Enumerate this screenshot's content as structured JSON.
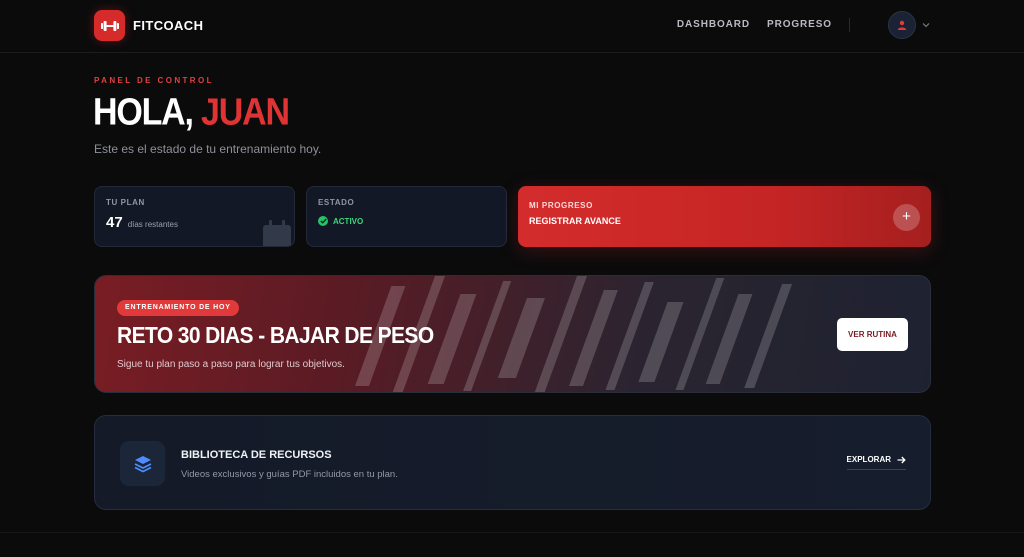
{
  "header": {
    "brand": "FITCOACH",
    "nav": [
      {
        "label": "DASHBOARD"
      },
      {
        "label": "PROGRESO"
      }
    ]
  },
  "hero": {
    "eyebrow": "PANEL DE CONTROL",
    "greeting": "HOLA,",
    "name": "JUAN",
    "subtitle": "Este es el estado de tu entrenamiento hoy."
  },
  "stats": {
    "plan": {
      "label": "TU PLAN",
      "value": "47",
      "unit": "días restantes"
    },
    "status": {
      "label": "ESTADO",
      "value": "ACTIVO"
    },
    "progress": {
      "label": "MI PROGRESO",
      "action": "REGISTRAR AVANCE",
      "button": "+"
    }
  },
  "workout": {
    "badge": "ENTRENAMIENTO DE HOY",
    "title": "RETO 30 DIAS - BAJAR DE PESO",
    "description": "Sigue tu plan paso a paso para lograr tus objetivos.",
    "button": "VER RUTINA"
  },
  "library": {
    "title": "BIBLIOTECA DE RECURSOS",
    "description": "Videos exclusivos y guías PDF incluidos en tu plan.",
    "link": "EXPLORAR"
  },
  "colors": {
    "accent": "#d62b2b",
    "active": "#27c26a",
    "background": "#0b0b0c"
  }
}
